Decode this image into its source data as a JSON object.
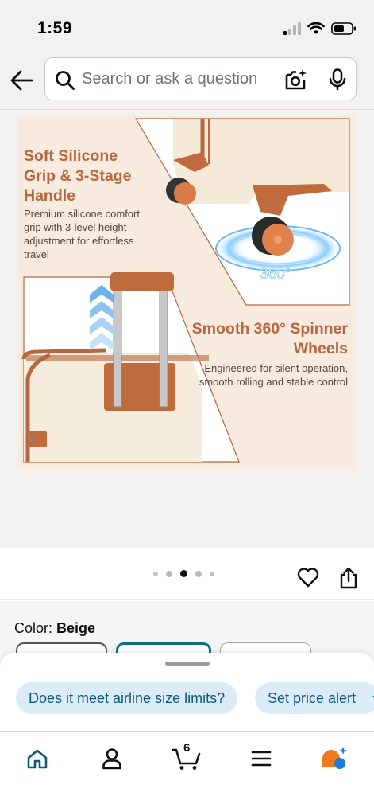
{
  "status_bar": {
    "time": "1:59"
  },
  "search": {
    "placeholder": "Search or ask a question"
  },
  "infographic": {
    "left_title": "Soft Silicone Grip & 3-Stage Handle",
    "left_body": "Premium silicone comfort grip with 3-level height adjustment for effortless travel",
    "right_title": "Smooth 360° Spinner Wheels",
    "right_body": "Engineered for silent operation, smooth rolling and stable control",
    "badge": "360°"
  },
  "gallery": {
    "dot_count": 5,
    "active_dot": 3
  },
  "color": {
    "label": "Color:",
    "value": "Beige"
  },
  "suggestions": [
    {
      "label": "Does it meet airline size limits?"
    },
    {
      "label": "Set price alert"
    }
  ],
  "nav": {
    "cart_count": "6"
  },
  "colors": {
    "accent_brown": "#b5673d",
    "chip_bg": "#dcecf7",
    "chip_text": "#0b5a7d",
    "nav_home": "#0b5a7d",
    "selected_swatch": "#0e6f82"
  }
}
